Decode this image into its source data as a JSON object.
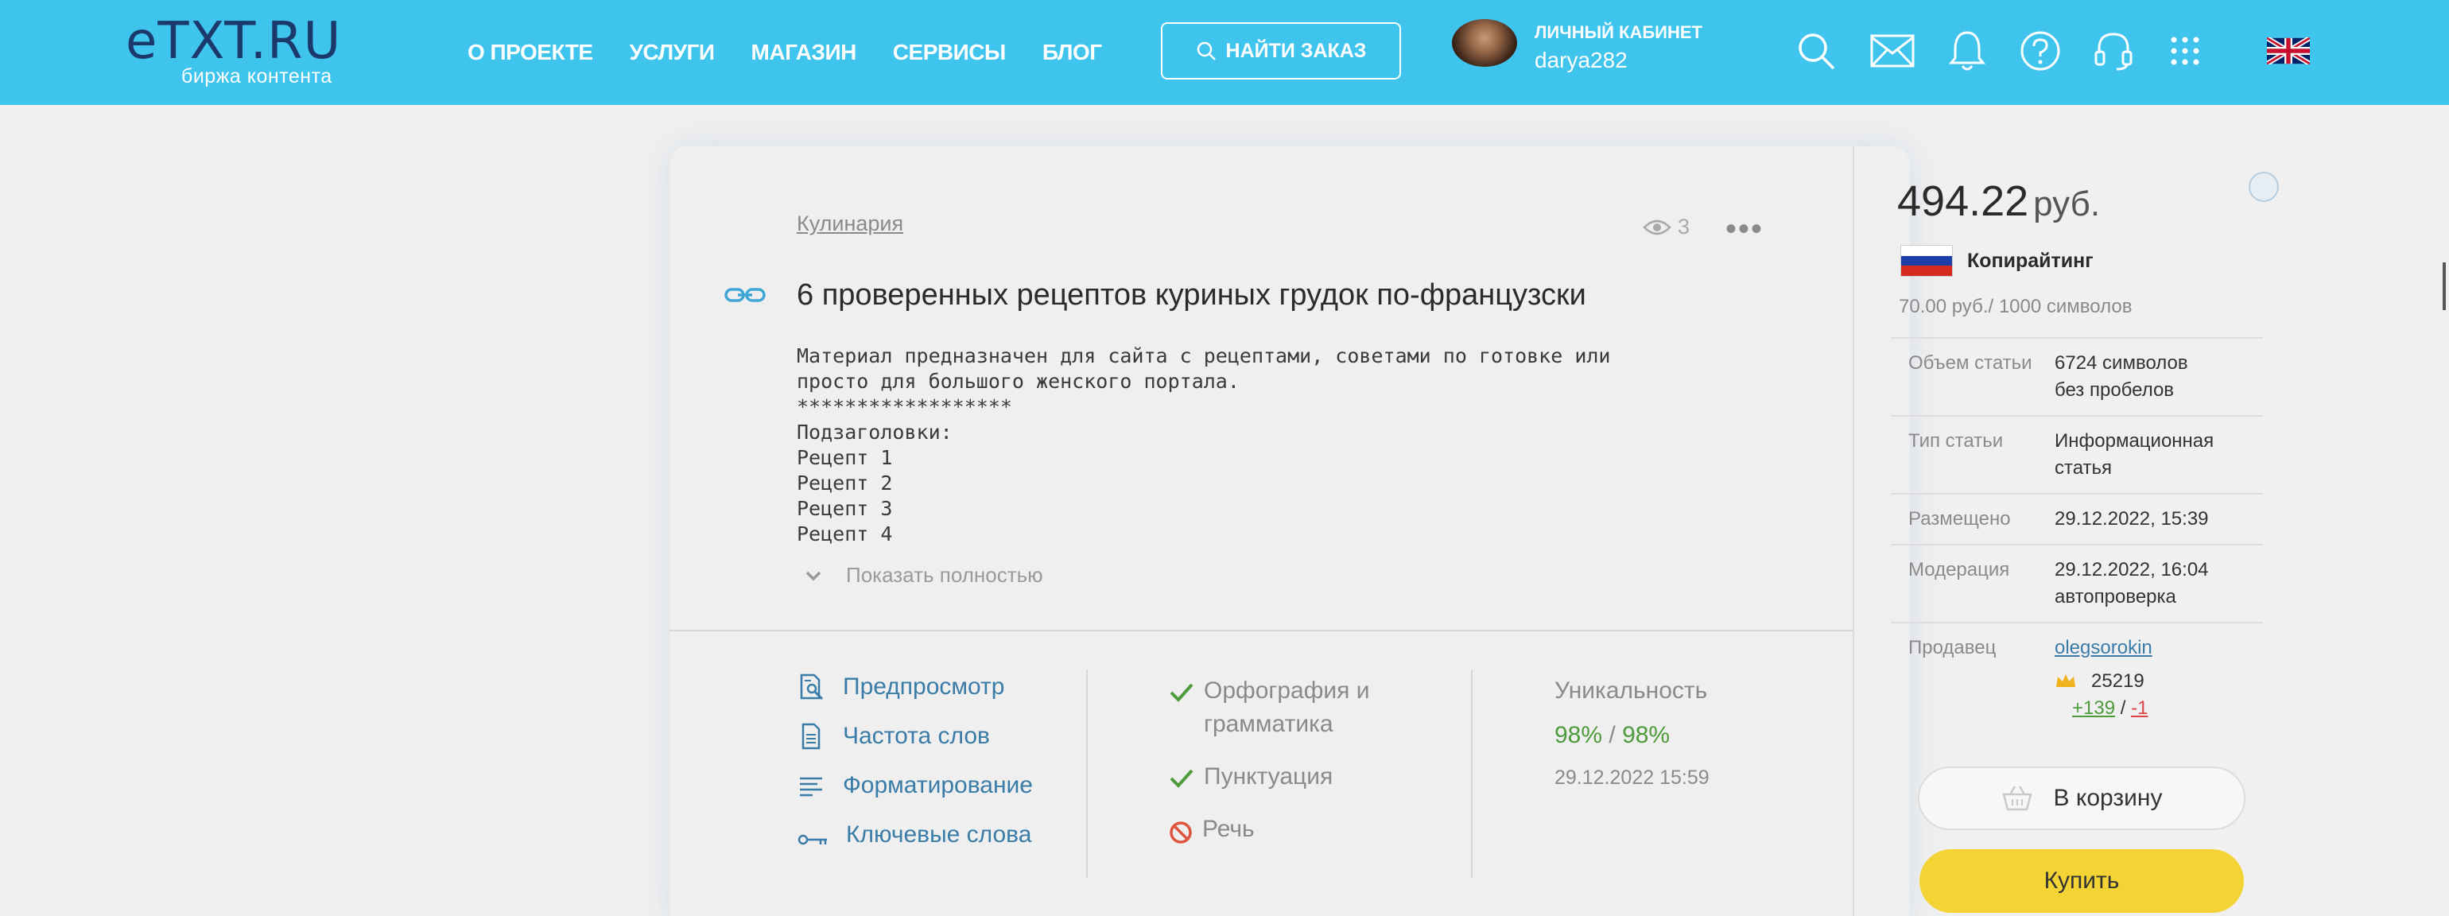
{
  "header": {
    "logo_text": "eTXT.RU",
    "logo_sub": "биржа контента",
    "nav": [
      "О ПРОЕКТЕ",
      "УСЛУГИ",
      "МАГАЗИН",
      "СЕРВИСЫ",
      "БЛОГ"
    ],
    "find_order": "НАЙТИ ЗАКАЗ",
    "cabinet_label": "ЛИЧНЫЙ КАБИНЕТ",
    "username": "darya282",
    "icons": [
      "search-icon",
      "mail-icon",
      "bell-icon",
      "help-icon",
      "headset-icon",
      "apps-grid-icon",
      "uk-flag-icon"
    ]
  },
  "article": {
    "category": "Кулинария",
    "views": "3",
    "title": "6 проверенных рецептов куриных грудок по-французски",
    "description": "Материал предназначен для сайта с рецептами, советами по готовке или\nпросто для большого женского портала.\n******************\nПодзаголовки:\nРецепт 1\nРецепт 2\nРецепт 3\nРецепт 4",
    "show_full": "Показать полностью"
  },
  "tools": [
    "Предпросмотр",
    "Частота слов",
    "Форматирование",
    "Ключевые слова"
  ],
  "checks": {
    "spelling": "Орфография и\nграмматика",
    "punctuation": "Пунктуация",
    "speech": "Речь"
  },
  "uniqueness": {
    "label": "Уникальность",
    "value1": "98%",
    "sep": " / ",
    "value2": "98%",
    "date": "29.12.2022 15:59"
  },
  "panel": {
    "price": "494.22",
    "currency": "руб.",
    "type": "Копирайтинг",
    "rate": "70.00 руб./ 1000 символов",
    "info": [
      {
        "key": "Объем статьи",
        "value": "6724 символов\nбез пробелов"
      },
      {
        "key": "Тип статьи",
        "value": "Информационная\nстатья"
      },
      {
        "key": "Размещено",
        "value": "29.12.2022, 15:39"
      },
      {
        "key": "Модерация",
        "value": "29.12.2022, 16:04\nавтопроверка"
      }
    ],
    "seller_key": "Продавец",
    "seller_name": "olegsorokin",
    "seller_rating": "25219",
    "votes_up": "+139",
    "votes_sep": " / ",
    "votes_down": "-1",
    "cart_button": "В корзину",
    "buy_button": "Купить"
  },
  "colors": {
    "header_bg": "#3fc4ee",
    "link": "#3a7ca8",
    "ok_green": "#4d9b3c",
    "buy_yellow": "#f4d335"
  }
}
